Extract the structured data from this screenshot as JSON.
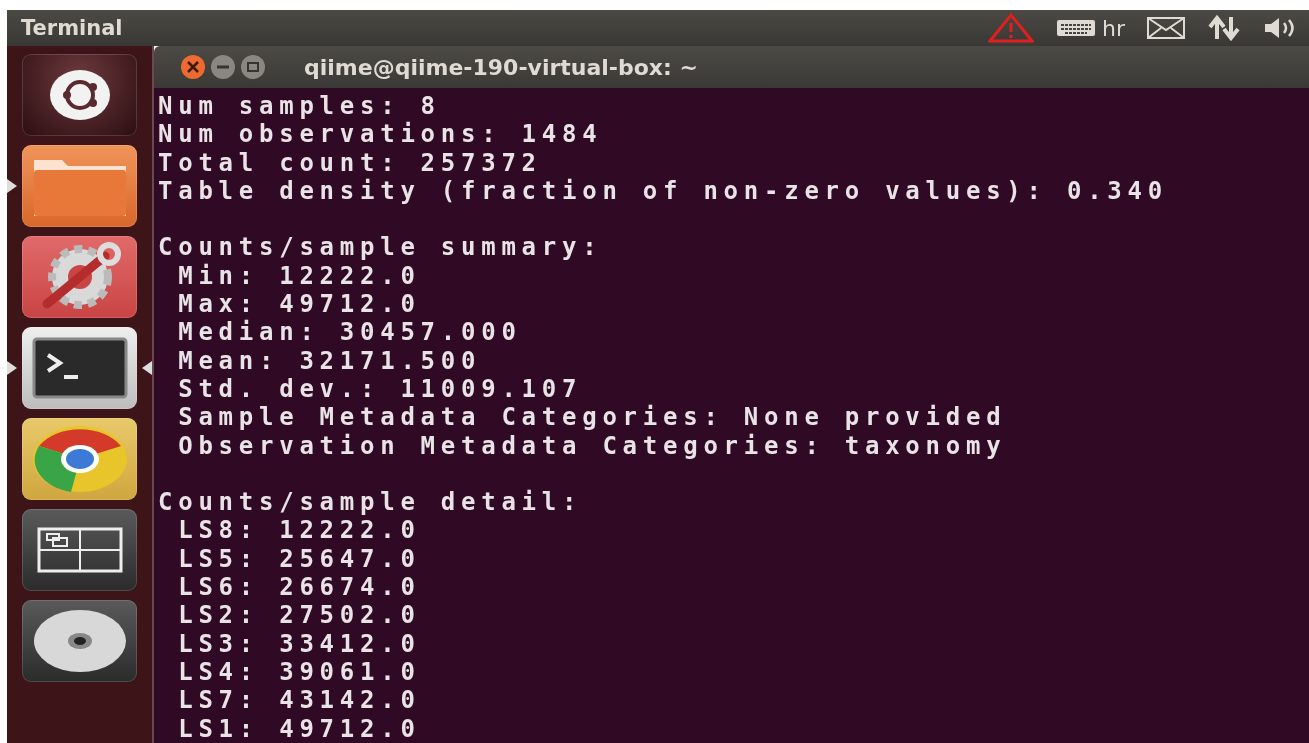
{
  "top_panel": {
    "title": "Terminal",
    "keyboard_layout": "hr"
  },
  "launcher": [
    {
      "kind": "dash",
      "running": false,
      "focused": false
    },
    {
      "kind": "files",
      "running": true,
      "focused": false
    },
    {
      "kind": "settings",
      "running": false,
      "focused": false
    },
    {
      "kind": "terminal",
      "running": true,
      "focused": true
    },
    {
      "kind": "browser",
      "running": false,
      "focused": false
    },
    {
      "kind": "workspaces",
      "running": false,
      "focused": false
    },
    {
      "kind": "disc",
      "running": false,
      "focused": false
    }
  ],
  "window": {
    "title": "qiime@qiime-190-virtual-box: ~",
    "blocks": [
      [
        "Num samples: 8",
        "Num observations: 1484",
        "Total count: 257372",
        "Table density (fraction of non-zero values): 0.340"
      ],
      [
        "Counts/sample summary:",
        " Min: 12222.0",
        " Max: 49712.0",
        " Median: 30457.000",
        " Mean: 32171.500",
        " Std. dev.: 11009.107",
        " Sample Metadata Categories: None provided",
        " Observation Metadata Categories: taxonomy"
      ],
      [
        "Counts/sample detail:",
        " LS8: 12222.0",
        " LS5: 25647.0",
        " LS6: 26674.0",
        " LS2: 27502.0",
        " LS3: 33412.0",
        " LS4: 39061.0",
        " LS7: 43142.0",
        " LS1: 49712.0"
      ]
    ]
  }
}
